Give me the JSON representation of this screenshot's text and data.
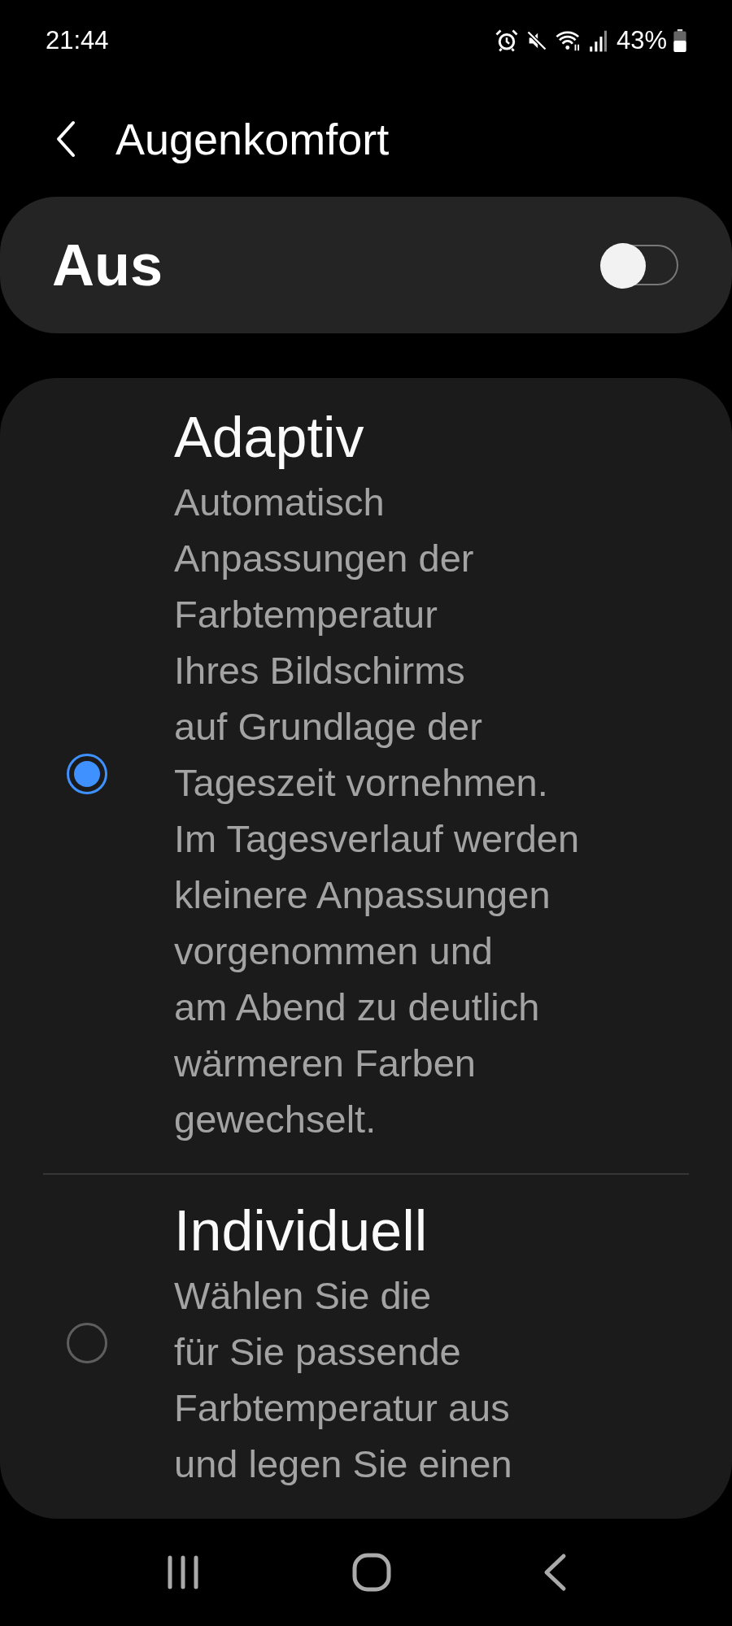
{
  "status_bar": {
    "time": "21:44",
    "battery": "43%"
  },
  "header": {
    "title": "Augenkomfort"
  },
  "master": {
    "label": "Aus",
    "on": false
  },
  "options": [
    {
      "title": "Adaptiv",
      "description": "Automatisch\nAnpassungen der\nFarbtemperatur\nIhres Bildschirms\nauf Grundlage der\nTageszeit vornehmen.\nIm Tagesverlauf werden\nkleinere Anpassungen\nvorgenommen und\nam Abend zu deutlich\nwärmeren Farben\ngewechselt.",
      "selected": true
    },
    {
      "title": "Individuell",
      "description": "Wählen Sie die\nfür Sie passende\nFarbtemperatur aus\nund legen Sie einen",
      "selected": false
    }
  ]
}
